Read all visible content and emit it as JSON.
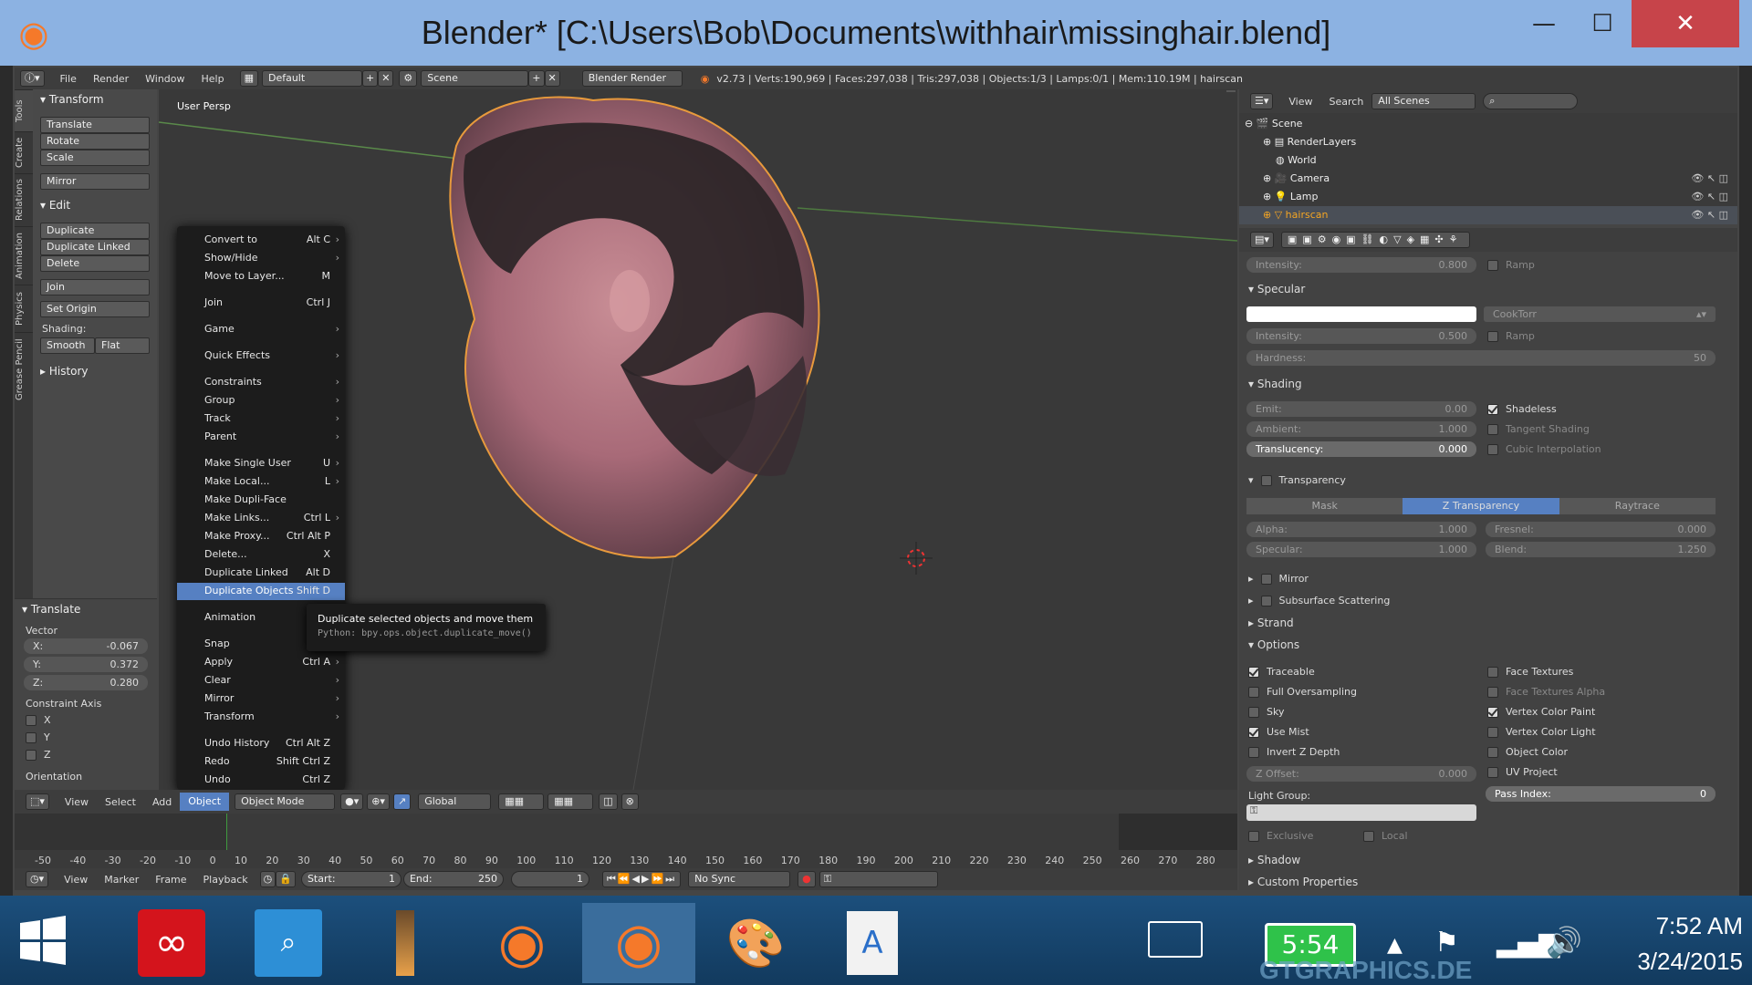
{
  "window": {
    "title": "Blender* [C:\\Users\\Bob\\Documents\\withhair\\missinghair.blend]",
    "minimize": "—",
    "maximize": "☐",
    "close": "✕"
  },
  "info_header": {
    "menus": [
      "File",
      "Render",
      "Window",
      "Help"
    ],
    "layout": "Default",
    "scene": "Scene",
    "engine": "Blender Render",
    "stats": "v2.73 | Verts:190,969 | Faces:297,038 | Tris:297,038 | Objects:1/3 | Lamps:0/1 | Mem:110.19M | hairscan"
  },
  "toolshelf": {
    "tabs": [
      "Tools",
      "Create",
      "Relations",
      "Animation",
      "Physics",
      "Grease Pencil"
    ],
    "transform_title": "Transform",
    "transform_buttons": [
      "Translate",
      "Rotate",
      "Scale"
    ],
    "mirror": "Mirror",
    "edit_title": "Edit",
    "edit_buttons": [
      "Duplicate",
      "Duplicate Linked",
      "Delete"
    ],
    "join": "Join",
    "set_origin": "Set Origin",
    "shading_label": "Shading:",
    "smooth": "Smooth",
    "flat": "Flat",
    "history": "History"
  },
  "redo_panel": {
    "title": "Translate",
    "vector_label": "Vector",
    "x_label": "X:",
    "x": "-0.067",
    "y_label": "Y:",
    "y": "0.372",
    "z_label": "Z:",
    "z": "0.280",
    "constraint_label": "Constraint Axis",
    "axes": [
      "X",
      "Y",
      "Z"
    ],
    "orientation": "Orientation"
  },
  "viewport": {
    "label": "User Persp"
  },
  "context_menu": {
    "items": [
      {
        "label": "Convert to",
        "shortcut": "Alt C",
        "sub": true
      },
      {
        "label": "Show/Hide",
        "shortcut": "",
        "sub": true
      },
      {
        "label": "Move to Layer...",
        "shortcut": "M",
        "sub": false
      },
      {
        "label": "Join",
        "shortcut": "Ctrl J",
        "sub": false
      },
      {
        "label": "Game",
        "shortcut": "",
        "sub": true
      },
      {
        "label": "Quick Effects",
        "shortcut": "",
        "sub": true
      },
      {
        "label": "Constraints",
        "shortcut": "",
        "sub": true
      },
      {
        "label": "Group",
        "shortcut": "",
        "sub": true
      },
      {
        "label": "Track",
        "shortcut": "",
        "sub": true
      },
      {
        "label": "Parent",
        "shortcut": "",
        "sub": true
      },
      {
        "label": "Make Single User",
        "shortcut": "U",
        "sub": true
      },
      {
        "label": "Make Local...",
        "shortcut": "L",
        "sub": true
      },
      {
        "label": "Make Dupli-Face",
        "shortcut": "",
        "sub": false
      },
      {
        "label": "Make Links...",
        "shortcut": "Ctrl L",
        "sub": true
      },
      {
        "label": "Make Proxy...",
        "shortcut": "Ctrl Alt P",
        "sub": false
      },
      {
        "label": "Delete...",
        "shortcut": "X",
        "sub": false
      },
      {
        "label": "Duplicate Linked",
        "shortcut": "Alt D",
        "sub": false
      },
      {
        "label": "Duplicate Objects",
        "shortcut": "Shift D",
        "sub": false
      },
      {
        "label": "Animation",
        "shortcut": "",
        "sub": true
      },
      {
        "label": "Snap",
        "shortcut": "S",
        "sub": true
      },
      {
        "label": "Apply",
        "shortcut": "Ctrl A",
        "sub": true
      },
      {
        "label": "Clear",
        "shortcut": "",
        "sub": true
      },
      {
        "label": "Mirror",
        "shortcut": "",
        "sub": true
      },
      {
        "label": "Transform",
        "shortcut": "",
        "sub": true
      },
      {
        "label": "Undo History",
        "shortcut": "Ctrl Alt Z",
        "sub": false
      },
      {
        "label": "Redo",
        "shortcut": "Shift Ctrl Z",
        "sub": false
      },
      {
        "label": "Undo",
        "shortcut": "Ctrl Z",
        "sub": false
      }
    ]
  },
  "tooltip": {
    "text": "Duplicate selected objects and move them",
    "python": "Python: bpy.ops.object.duplicate_move()"
  },
  "view3d_header": {
    "menus": [
      "View",
      "Select",
      "Add",
      "Object"
    ],
    "mode": "Object Mode",
    "orientation": "Global"
  },
  "timeline": {
    "ticks": [
      "-50",
      "-40",
      "-30",
      "-20",
      "-10",
      "0",
      "10",
      "20",
      "30",
      "40",
      "50",
      "60",
      "70",
      "80",
      "90",
      "100",
      "110",
      "120",
      "130",
      "140",
      "150",
      "160",
      "170",
      "180",
      "190",
      "200",
      "210",
      "220",
      "230",
      "240",
      "250",
      "260",
      "270",
      "280"
    ],
    "menus": [
      "View",
      "Marker",
      "Frame",
      "Playback"
    ],
    "start_label": "Start:",
    "start": "1",
    "end_label": "End:",
    "end": "250",
    "current": "1",
    "sync": "No Sync"
  },
  "outliner": {
    "menus": [
      "View",
      "Search"
    ],
    "scenes": "All Scenes",
    "rows": [
      {
        "label": "Scene",
        "indent": 0
      },
      {
        "label": "RenderLayers",
        "indent": 1
      },
      {
        "label": "World",
        "indent": 1
      },
      {
        "label": "Camera",
        "indent": 1
      },
      {
        "label": "Lamp",
        "indent": 1
      },
      {
        "label": "hairscan",
        "indent": 1
      }
    ]
  },
  "properties": {
    "intensity_top_label": "Intensity:",
    "intensity_top": "0.800",
    "ramp": "Ramp",
    "specular_title": "Specular",
    "cooktorr": "CookTorr",
    "spec_intensity_label": "Intensity:",
    "spec_intensity": "0.500",
    "hardness_label": "Hardness:",
    "hardness": "50",
    "shading_title": "Shading",
    "emit_label": "Emit:",
    "emit": "0.00",
    "ambient_label": "Ambient:",
    "ambient": "1.000",
    "translucency_label": "Translucency:",
    "translucency": "0.000",
    "shadeless": "Shadeless",
    "tangent": "Tangent Shading",
    "cubic": "Cubic Interpolation",
    "transparency_title": "Transparency",
    "mask": "Mask",
    "ztrans": "Z Transparency",
    "raytrace": "Raytrace",
    "alpha_label": "Alpha:",
    "alpha": "1.000",
    "fresnel_label": "Fresnel:",
    "fresnel": "0.000",
    "specular_label": "Specular:",
    "specular": "1.000",
    "blend_label": "Blend:",
    "blend": "1.250",
    "mirror_title": "Mirror",
    "sss_title": "Subsurface Scattering",
    "strand_title": "Strand",
    "options_title": "Options",
    "opt_left": [
      {
        "label": "Traceable",
        "on": true
      },
      {
        "label": "Full Oversampling",
        "on": false
      },
      {
        "label": "Sky",
        "on": false
      },
      {
        "label": "Use Mist",
        "on": true
      },
      {
        "label": "Invert Z Depth",
        "on": false
      }
    ],
    "opt_right": [
      {
        "label": "Face Textures",
        "on": false
      },
      {
        "label": "Face Textures Alpha",
        "on": false
      },
      {
        "label": "Vertex Color Paint",
        "on": true
      },
      {
        "label": "Vertex Color Light",
        "on": false
      },
      {
        "label": "Object Color",
        "on": false
      },
      {
        "label": "UV Project",
        "on": false
      }
    ],
    "zoffset_label": "Z Offset:",
    "zoffset": "0.000",
    "pass_label": "Pass Index:",
    "pass": "0",
    "light_group": "Light Group:",
    "exclusive": "Exclusive",
    "local": "Local",
    "shadow_title": "Shadow",
    "custom_title": "Custom Properties"
  },
  "taskbar": {
    "battery": "5:54",
    "time": "7:52 AM",
    "date": "3/24/2015",
    "watermark": "GTGRAPHICS.DE"
  }
}
